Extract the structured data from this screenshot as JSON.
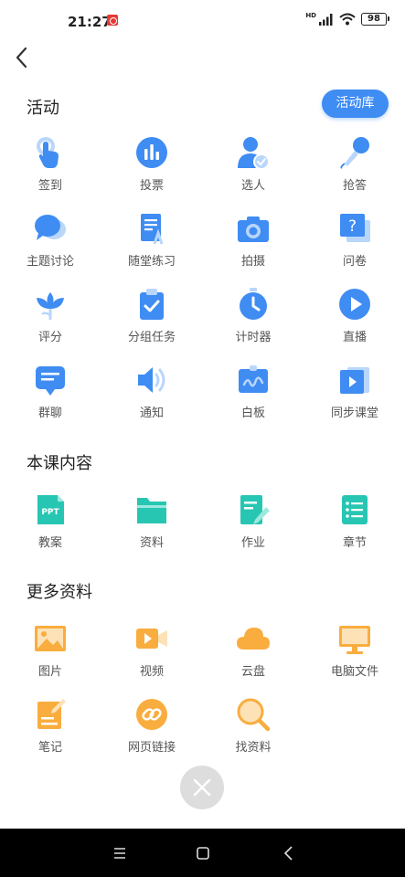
{
  "status": {
    "time": "21:27",
    "network": "HD",
    "battery": "98"
  },
  "sections": {
    "activity": {
      "title": "活动",
      "library_button": "活动库",
      "items": [
        {
          "label": "签到",
          "icon": "tap-checkin-icon"
        },
        {
          "label": "投票",
          "icon": "bar-chart-vote-icon"
        },
        {
          "label": "选人",
          "icon": "person-select-icon"
        },
        {
          "label": "抢答",
          "icon": "microphone-icon"
        },
        {
          "label": "主题讨论",
          "icon": "chat-bubbles-icon"
        },
        {
          "label": "随堂练习",
          "icon": "exercise-doc-icon"
        },
        {
          "label": "拍摄",
          "icon": "camera-icon"
        },
        {
          "label": "问卷",
          "icon": "questionnaire-icon"
        },
        {
          "label": "评分",
          "icon": "flower-rating-icon"
        },
        {
          "label": "分组任务",
          "icon": "clipboard-check-icon"
        },
        {
          "label": "计时器",
          "icon": "timer-icon"
        },
        {
          "label": "直播",
          "icon": "play-circle-icon"
        },
        {
          "label": "群聊",
          "icon": "group-chat-icon"
        },
        {
          "label": "通知",
          "icon": "speaker-icon"
        },
        {
          "label": "白板",
          "icon": "whiteboard-icon"
        },
        {
          "label": "同步课堂",
          "icon": "sync-class-icon"
        }
      ]
    },
    "course": {
      "title": "本课内容",
      "items": [
        {
          "label": "教案",
          "icon": "ppt-icon",
          "badge": "PPT"
        },
        {
          "label": "资料",
          "icon": "folder-icon"
        },
        {
          "label": "作业",
          "icon": "homework-icon"
        },
        {
          "label": "章节",
          "icon": "chapter-list-icon"
        }
      ]
    },
    "more": {
      "title": "更多资料",
      "items": [
        {
          "label": "图片",
          "icon": "image-icon"
        },
        {
          "label": "视频",
          "icon": "video-icon"
        },
        {
          "label": "云盘",
          "icon": "cloud-icon"
        },
        {
          "label": "电脑文件",
          "icon": "monitor-icon"
        },
        {
          "label": "笔记",
          "icon": "note-icon"
        },
        {
          "label": "网页链接",
          "icon": "link-icon"
        },
        {
          "label": "找资料",
          "icon": "search-icon"
        }
      ]
    }
  },
  "colors": {
    "blue": "#3f8cf3",
    "teal": "#27c6b2",
    "orange": "#f9ad3e",
    "accent_button": "#3f8cf3"
  }
}
